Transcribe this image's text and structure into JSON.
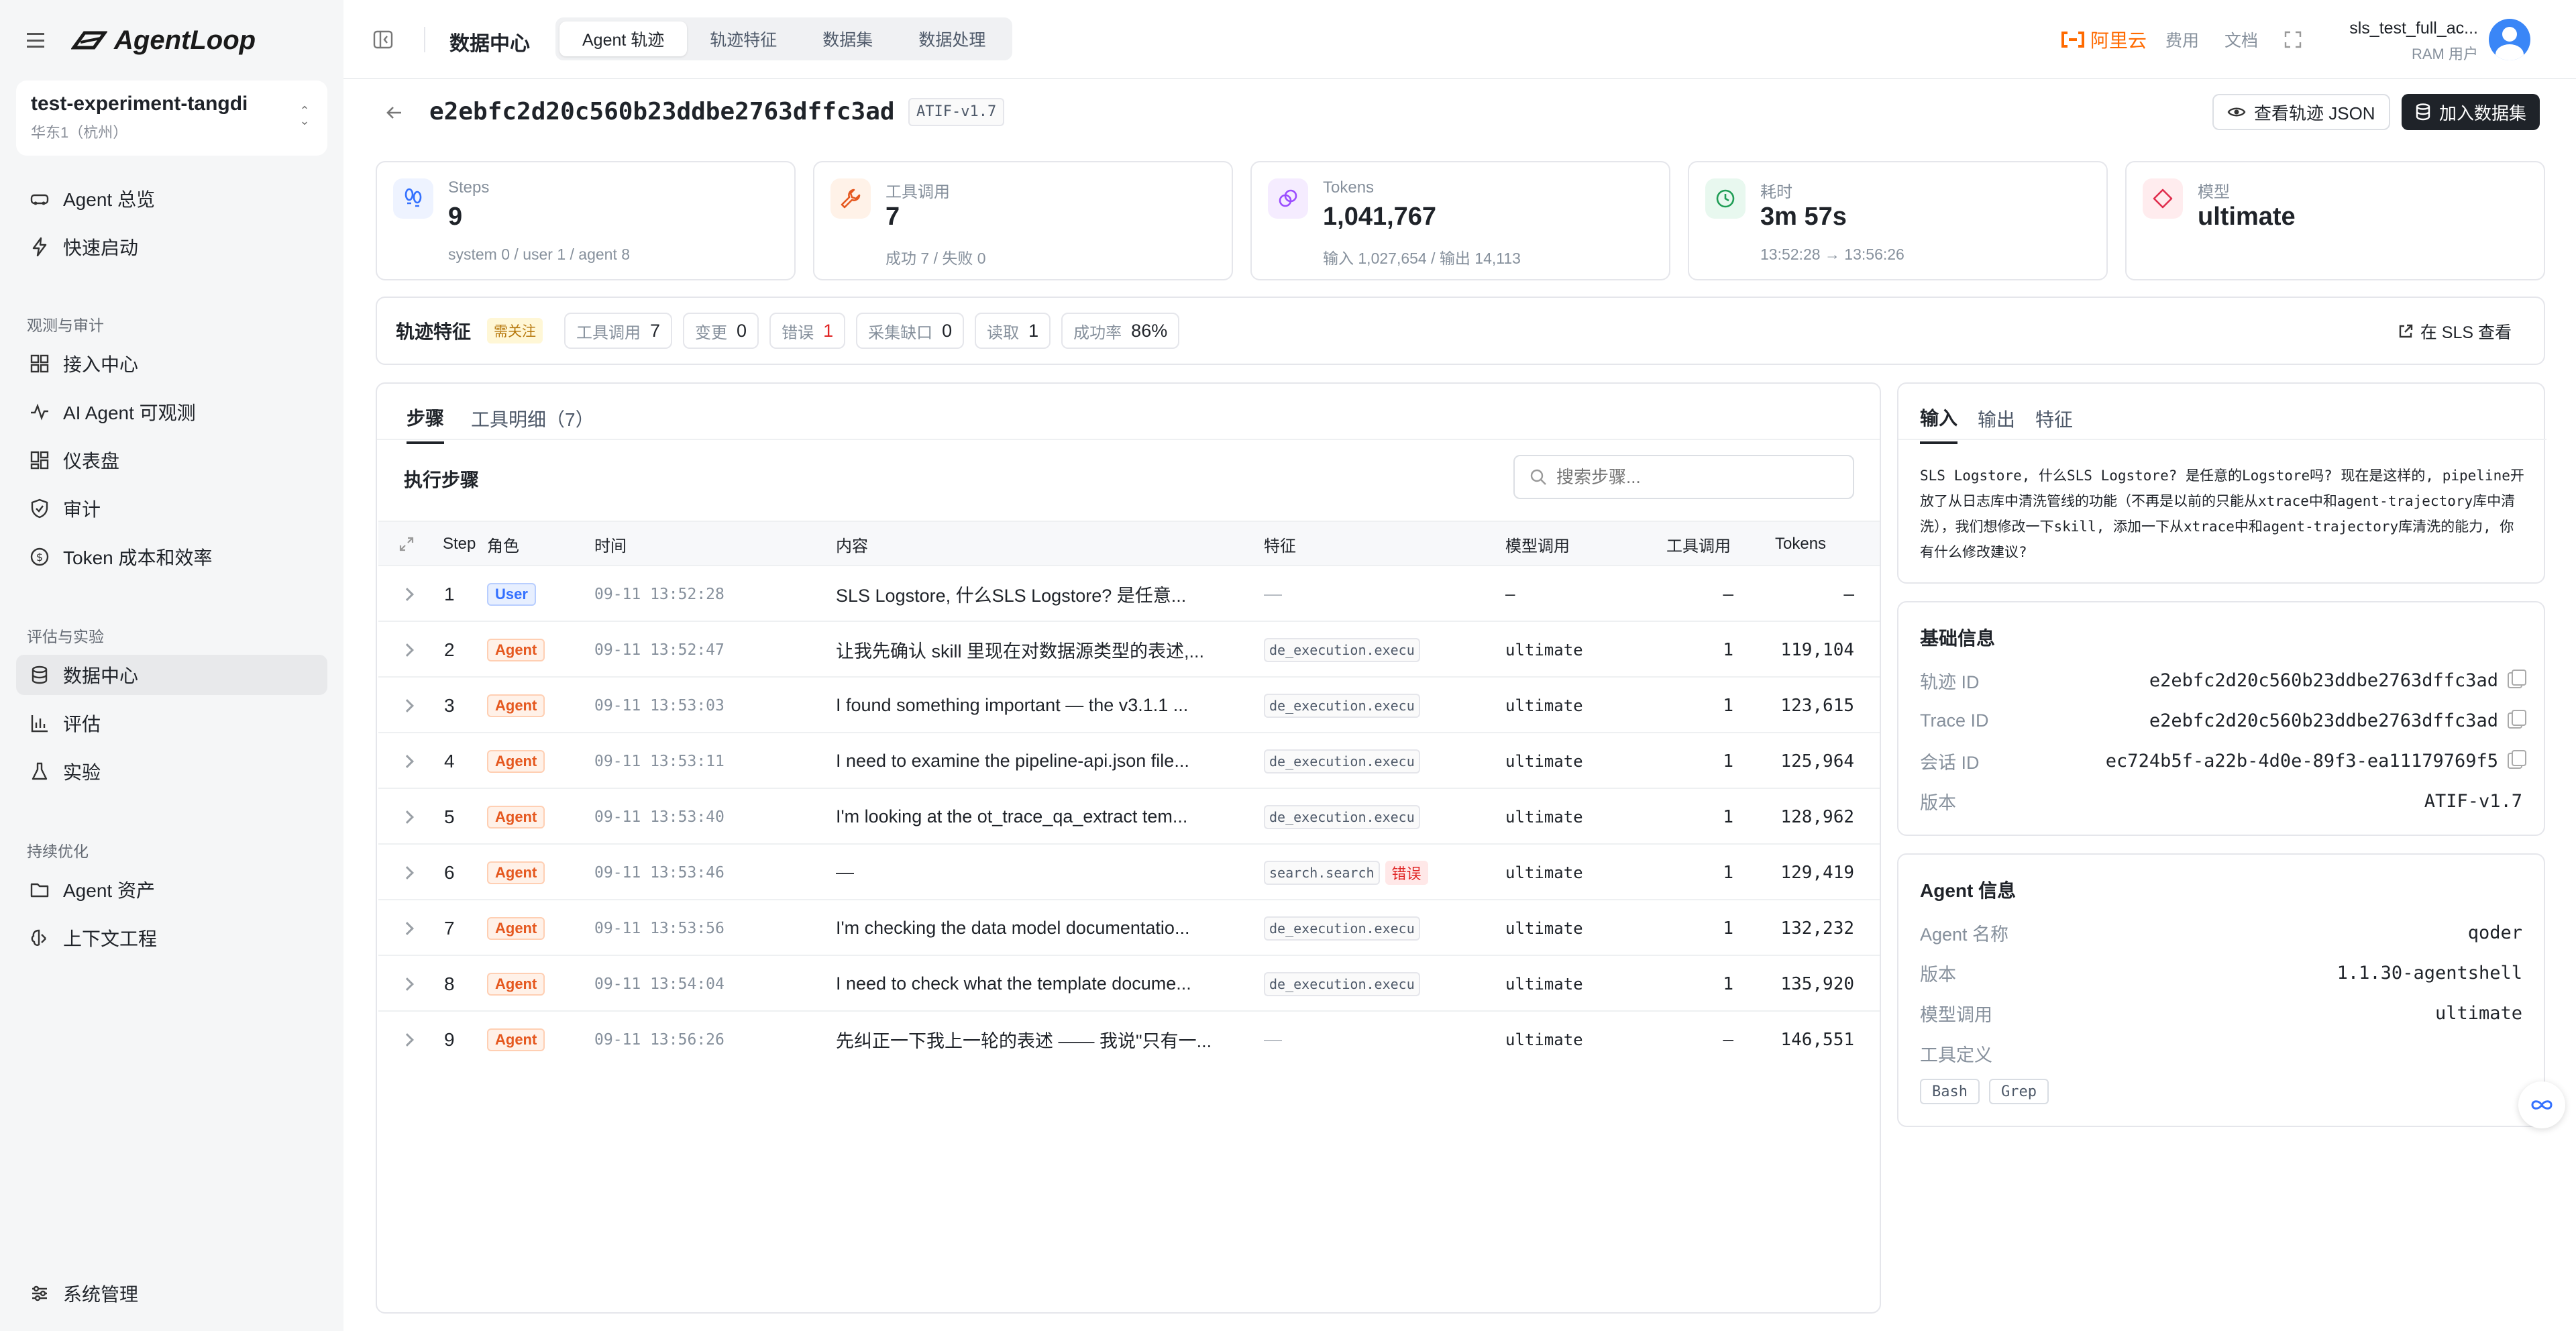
{
  "app": {
    "name": "AgentLoop"
  },
  "project": {
    "name": "test-experiment-tangdi",
    "region": "华东1（杭州）"
  },
  "nav": {
    "overview": "Agent 总览",
    "quickstart": "快速启动",
    "sec_observe": "观测与审计",
    "ingest": "接入中心",
    "ai_observe": "AI Agent 可观测",
    "dashboard": "仪表盘",
    "audit": "审计",
    "token_cost": "Token 成本和效率",
    "sec_eval": "评估与实验",
    "data_center": "数据中心",
    "eval": "评估",
    "experiment": "实验",
    "sec_opt": "持续优化",
    "assets": "Agent 资产",
    "context_eng": "上下文工程",
    "system": "系统管理"
  },
  "topbar": {
    "title": "数据中心",
    "tabs": [
      "Agent 轨迹",
      "轨迹特征",
      "数据集",
      "数据处理"
    ],
    "cloud": "阿里云",
    "fee": "费用",
    "docs": "文档",
    "user_name": "sls_test_full_ac...",
    "user_type": "RAM 用户"
  },
  "header": {
    "trace_id": "e2ebfc2d20c560b23ddbe2763dffc3ad",
    "version": "ATIF-v1.7",
    "view_json": "查看轨迹 JSON",
    "add_dataset": "加入数据集"
  },
  "stats": [
    {
      "label": "Steps",
      "value": "9",
      "sub": "system 0 / user 1 / agent 8"
    },
    {
      "label": "工具调用",
      "value": "7",
      "sub": "成功 7 / 失败 0"
    },
    {
      "label": "Tokens",
      "value": "1,041,767",
      "sub": "输入 1,027,654 / 输出 14,113"
    },
    {
      "label": "耗时",
      "value": "3m 57s",
      "sub": "13:52:28 → 13:56:26"
    },
    {
      "label": "模型",
      "value": "ultimate",
      "sub": ""
    }
  ],
  "features": {
    "title": "轨迹特征",
    "flag": "需关注",
    "sls": "在 SLS 查看",
    "chips": [
      {
        "label": "工具调用",
        "value": "7"
      },
      {
        "label": "变更",
        "value": "0"
      },
      {
        "label": "错误",
        "value": "1"
      },
      {
        "label": "采集缺口",
        "value": "0"
      },
      {
        "label": "读取",
        "value": "1"
      },
      {
        "label": "成功率",
        "value": "86%"
      }
    ]
  },
  "steps_panel": {
    "tabs": [
      "步骤",
      "工具明细（7）"
    ],
    "title": "执行步骤",
    "search_placeholder": "搜索步骤...",
    "columns": [
      "Step",
      "角色",
      "时间",
      "内容",
      "特征",
      "模型调用",
      "工具调用",
      "Tokens"
    ],
    "rows": [
      {
        "step": "1",
        "role": "User",
        "time": "09-11 13:52:28",
        "content": "SLS Logstore, 什么SLS Logstore? 是任意...",
        "feature": "—",
        "model": "–",
        "tools": "—",
        "tokens": "–"
      },
      {
        "step": "2",
        "role": "Agent",
        "time": "09-11 13:52:47",
        "content": "让我先确认 skill 里现在对数据源类型的表述,...",
        "feature": "de_execution.execu",
        "model": "ultimate",
        "tools": "1",
        "tokens": "119,104"
      },
      {
        "step": "3",
        "role": "Agent",
        "time": "09-11 13:53:03",
        "content": "I found something important — the v3.1.1 ...",
        "feature": "de_execution.execu",
        "model": "ultimate",
        "tools": "1",
        "tokens": "123,615"
      },
      {
        "step": "4",
        "role": "Agent",
        "time": "09-11 13:53:11",
        "content": "I need to examine the pipeline-api.json file...",
        "feature": "de_execution.execu",
        "model": "ultimate",
        "tools": "1",
        "tokens": "125,964"
      },
      {
        "step": "5",
        "role": "Agent",
        "time": "09-11 13:53:40",
        "content": "I'm looking at the ot_trace_qa_extract tem...",
        "feature": "de_execution.execu",
        "model": "ultimate",
        "tools": "1",
        "tokens": "128,962"
      },
      {
        "step": "6",
        "role": "Agent",
        "time": "09-11 13:53:46",
        "content": "—",
        "feature": "search.search",
        "error": "错误",
        "model": "ultimate",
        "tools": "1",
        "tokens": "129,419"
      },
      {
        "step": "7",
        "role": "Agent",
        "time": "09-11 13:53:56",
        "content": "I'm checking the data model documentatio...",
        "feature": "de_execution.execu",
        "model": "ultimate",
        "tools": "1",
        "tokens": "132,232"
      },
      {
        "step": "8",
        "role": "Agent",
        "time": "09-11 13:54:04",
        "content": "I need to check what the template docume...",
        "feature": "de_execution.execu",
        "model": "ultimate",
        "tools": "1",
        "tokens": "135,920"
      },
      {
        "step": "9",
        "role": "Agent",
        "time": "09-11 13:56:26",
        "content": "先纠正一下我上一轮的表述 —— 我说\"只有一...",
        "feature": "—",
        "model": "ultimate",
        "tools": "—",
        "tokens": "146,551"
      }
    ]
  },
  "right": {
    "tabs": [
      "输入",
      "输出",
      "特征"
    ],
    "input_text": "SLS Logstore, 什么SLS Logstore? 是任意的Logstore吗? 现在是这样的, pipeline开放了从日志库中清洗管线的功能（不再是以前的只能从xtrace中和agent-trajectory库中清洗），我们想修改一下skill, 添加一下从xtrace中和agent-trajectory库清洗的能力, 你有什么修改建议?",
    "basic": {
      "title": "基础信息",
      "items": [
        {
          "k": "轨迹 ID",
          "v": "e2ebfc2d20c560b23ddbe2763dffc3ad"
        },
        {
          "k": "Trace ID",
          "v": "e2ebfc2d20c560b23ddbe2763dffc3ad"
        },
        {
          "k": "会话 ID",
          "v": "ec724b5f-a22b-4d0e-89f3-ea11179769f5"
        },
        {
          "k": "版本",
          "v": "ATIF-v1.7"
        }
      ]
    },
    "agent": {
      "title": "Agent 信息",
      "items": [
        {
          "k": "Agent 名称",
          "v": "qoder"
        },
        {
          "k": "版本",
          "v": "1.1.30-agentshell"
        },
        {
          "k": "模型调用",
          "v": "ultimate"
        }
      ],
      "tools_label": "工具定义",
      "tools": [
        "Bash",
        "Grep"
      ]
    }
  },
  "colors": {
    "accent": "#ff6a00",
    "agent": "#e5581f",
    "user": "#3370ff",
    "error": "#e02424"
  }
}
